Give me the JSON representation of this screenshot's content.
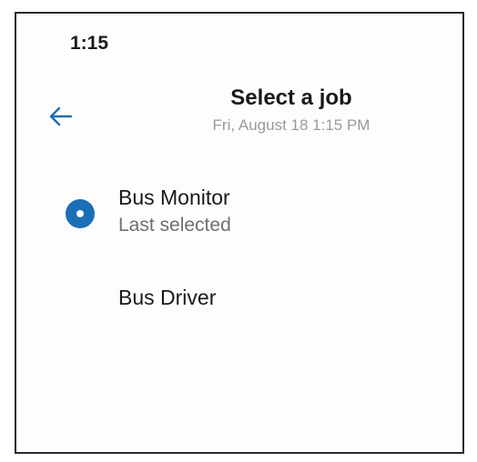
{
  "status_bar": {
    "time": "1:15"
  },
  "header": {
    "back_icon": "arrow-left-icon",
    "title": "Select a job",
    "subtitle": "Fri, August 18 1:15 PM"
  },
  "jobs": [
    {
      "name": "Bus Monitor",
      "sublabel": "Last selected",
      "selected": true
    },
    {
      "name": "Bus Driver",
      "selected": false
    }
  ],
  "colors": {
    "accent": "#1b6fb5",
    "subtitle": "#9a9a9a",
    "secondary_text": "#6f6f6f"
  }
}
